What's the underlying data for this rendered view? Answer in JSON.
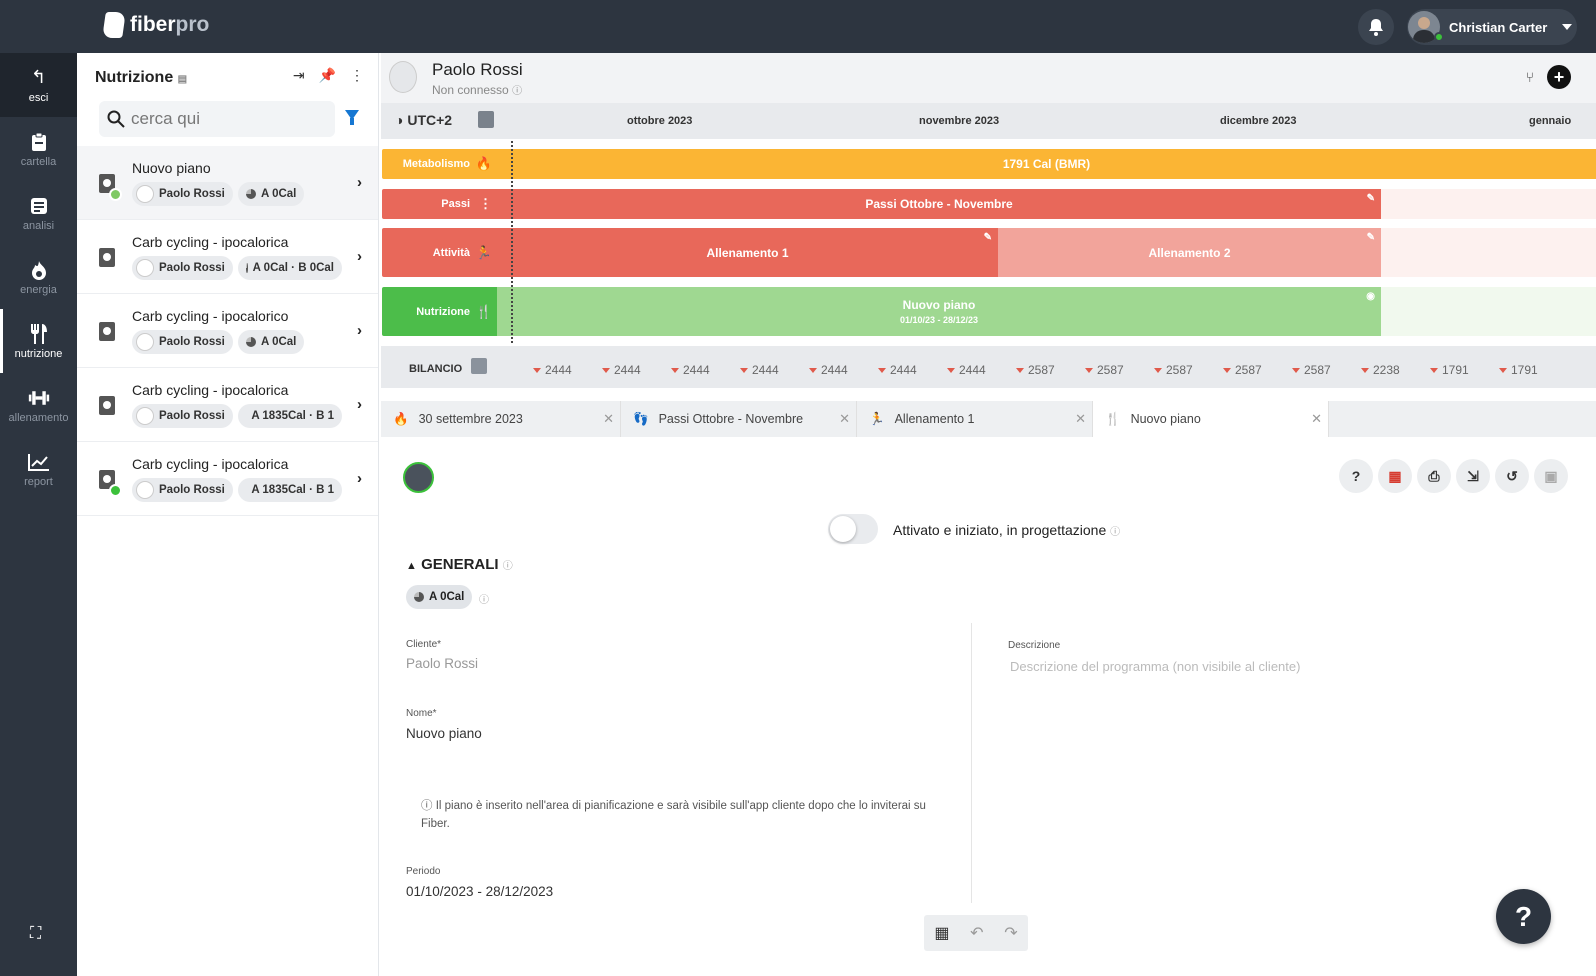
{
  "app": {
    "brand_main": "fiber",
    "brand_accent": "pro"
  },
  "topbar": {
    "user_name": "Christian Carter"
  },
  "leftnav": [
    {
      "label": "esci",
      "icon": "exit-icon"
    },
    {
      "label": "cartella",
      "icon": "clipboard-icon"
    },
    {
      "label": "analisi",
      "icon": "document-icon"
    },
    {
      "label": "energia",
      "icon": "flame-icon"
    },
    {
      "label": "nutrizione",
      "icon": "fork-knife-icon"
    },
    {
      "label": "allenamento",
      "icon": "dumbbell-icon"
    },
    {
      "label": "report",
      "icon": "chart-icon"
    }
  ],
  "sidepanel": {
    "title": "Nutrizione",
    "search_placeholder": "cerca qui",
    "plans": [
      {
        "title": "Nuovo piano",
        "client": "Paolo Rossi",
        "calories": "A 0Cal"
      },
      {
        "title": "Carb cycling - ipocalorica",
        "client": "Paolo Rossi",
        "calories": "A 0Cal · B 0Cal"
      },
      {
        "title": "Carb cycling - ipocalorico",
        "client": "Paolo Rossi",
        "calories": "A 0Cal"
      },
      {
        "title": "Carb cycling - ipocalorica",
        "client": "Paolo Rossi",
        "calories": "A 1835Cal · B 1"
      },
      {
        "title": "Carb cycling - ipocalorica",
        "client": "Paolo Rossi",
        "calories": "A 1835Cal · B 1"
      }
    ]
  },
  "patient": {
    "name": "Paolo Rossi",
    "status": "Non connesso"
  },
  "timeline": {
    "timezone": "UTC+2",
    "months": [
      "ottobre 2023",
      "novembre 2023",
      "dicembre 2023",
      "gennaio"
    ],
    "rows": [
      {
        "label": "Metabolismo",
        "bar": "1791 Cal (BMR)"
      },
      {
        "label": "Passi",
        "bar": "Passi Ottobre - Novembre"
      },
      {
        "label": "Attività",
        "bar1": "Allenamento 1",
        "bar2": "Allenamento 2"
      },
      {
        "label": "Nutrizione",
        "bar": "Nuovo piano",
        "sub": "01/10/23 - 28/12/23"
      }
    ],
    "bilancio_label": "BILANCIO",
    "bilancio_values": [
      "2444",
      "2444",
      "2444",
      "2444",
      "2444",
      "2444",
      "2444",
      "2587",
      "2587",
      "2587",
      "2587",
      "2587",
      "2238",
      "1791",
      "1791"
    ]
  },
  "tabs": [
    "30 settembre 2023",
    "Passi Ottobre - Novembre",
    "Allenamento 1",
    "Nuovo piano"
  ],
  "form": {
    "toggle_label": "Attivato e iniziato, in progettazione",
    "section_title": "GENERALI",
    "section_chip": "A 0Cal",
    "client_label": "Cliente*",
    "client_value": "Paolo Rossi",
    "name_label": "Nome*",
    "name_value": "Nuovo piano",
    "description_label": "Descrizione",
    "description_placeholder": "Descrizione del programma (non visibile al cliente)",
    "note": "Il piano è inserito nell'area di pianificazione e sarà visibile sull'app cliente dopo che lo inviterai su Fiber.",
    "period_label": "Periodo",
    "period_value": "01/10/2023 - 28/12/2023"
  },
  "colors": {
    "metabolismo": "#fbb534",
    "passi": "#e8685a",
    "attivita": "#e8685a",
    "attivita_light": "#f2a49b",
    "nutrizione": "#4cbd4a",
    "nutrizione_light": "#9fd891",
    "nav_bg": "#2d3540"
  }
}
